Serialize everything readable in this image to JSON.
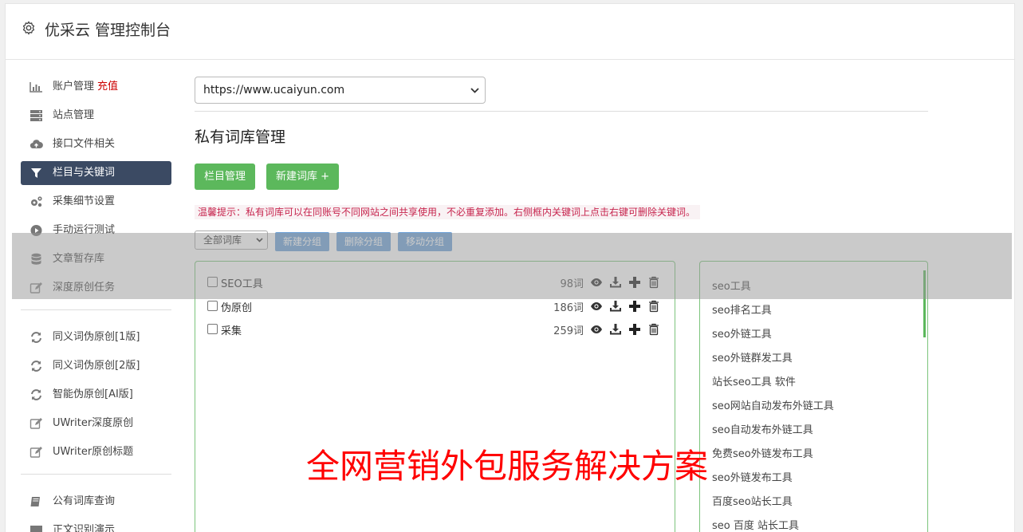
{
  "header": {
    "title": "优采云 管理控制台",
    "icon": "gear-icon"
  },
  "sidebar": {
    "items": [
      {
        "label": "账户管理",
        "extra": "充值",
        "icon": "bar-chart-icon"
      },
      {
        "label": "站点管理",
        "icon": "server-icon"
      },
      {
        "label": "接口文件相关",
        "icon": "cloud-upload-icon"
      },
      {
        "label": "栏目与关键词",
        "icon": "filter-icon",
        "active": true
      },
      {
        "label": "采集细节设置",
        "icon": "cogs-icon"
      },
      {
        "label": "手动运行测试",
        "icon": "play-circle-icon"
      },
      {
        "label": "文章暂存库",
        "icon": "database-icon"
      },
      {
        "label": "深度原创任务",
        "icon": "edit-icon"
      }
    ],
    "items2": [
      {
        "label": "同义词伪原创[1版]",
        "icon": "refresh-icon"
      },
      {
        "label": "同义词伪原创[2版]",
        "icon": "refresh-icon"
      },
      {
        "label": "智能伪原创[AI版]",
        "icon": "refresh-icon"
      },
      {
        "label": "UWriter深度原创",
        "icon": "edit-icon"
      },
      {
        "label": "UWriter原创标题",
        "icon": "edit-icon"
      }
    ],
    "items3": [
      {
        "label": "公有词库查询",
        "icon": "book-icon"
      },
      {
        "label": "正文识别演示",
        "icon": "monitor-icon"
      }
    ]
  },
  "main": {
    "site_select": "https://www.ucaiyun.com",
    "page_title": "私有词库管理",
    "btn_columns": "栏目管理",
    "btn_new_lib": "新建词库 +",
    "tip": "温馨提示：私有词库可以在同账号不同网站之间共享使用，不必重复添加。右侧框内关键词上点击右键可删除关键词。",
    "group_select": "全部词库",
    "btn_new_group": "新建分组",
    "btn_delete_group": "删除分组",
    "btn_move_group": "移动分组",
    "libraries": [
      {
        "name": "SEO工具",
        "count": "98词"
      },
      {
        "name": "伪原创",
        "count": "186词"
      },
      {
        "name": "采集",
        "count": "259词"
      }
    ],
    "keywords": [
      "seo工具",
      "seo排名工具",
      "seo外链工具",
      "seo外链群发工具",
      "站长seo工具 软件",
      "seo网站自动发布外链工具",
      "seo自动发布外链工具",
      "免费seo外链发布工具",
      "seo外链发布工具",
      "百度seo站长工具",
      "seo 百度 站长工具"
    ]
  },
  "overlay": {
    "banner": "全网营销外包服务解决方案"
  },
  "colors": {
    "active_nav": "#3b4a63",
    "green": "#5cb85c",
    "blue_btn": "#6fa3d9",
    "banner": "#ff0000",
    "recharge": "#cc0000"
  }
}
